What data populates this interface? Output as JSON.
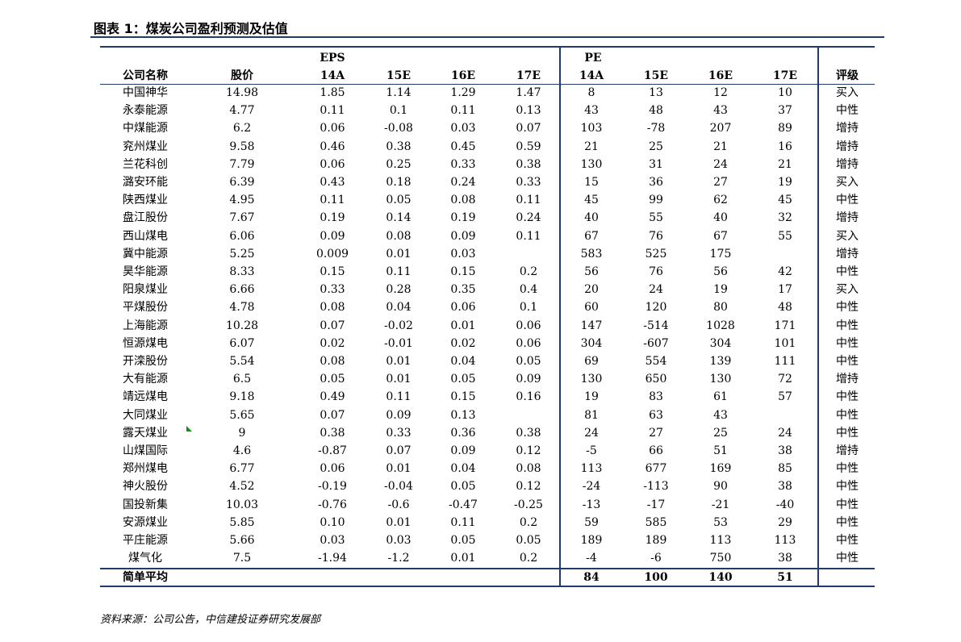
{
  "title": "图表 1：煤炭公司盈利预测及估值",
  "headers": {
    "eps_group": "EPS",
    "pe_group": "PE",
    "name": "公司名称",
    "price": "股价",
    "eps_14a": "14A",
    "eps_15e": "15E",
    "eps_16e": "16E",
    "eps_17e": "17E",
    "pe_14a": "14A",
    "pe_15e": "15E",
    "pe_16e": "16E",
    "pe_17e": "17E",
    "rating": "评级"
  },
  "rows": [
    {
      "name": "中国神华",
      "price": "14.98",
      "eps": [
        "1.85",
        "1.14",
        "1.29",
        "1.47"
      ],
      "pe": [
        "8",
        "13",
        "12",
        "10"
      ],
      "rating": "买入"
    },
    {
      "name": "永泰能源",
      "price": "4.77",
      "eps": [
        "0.11",
        "0.1",
        "0.11",
        "0.13"
      ],
      "pe": [
        "43",
        "48",
        "43",
        "37"
      ],
      "rating": "中性"
    },
    {
      "name": "中煤能源",
      "price": "6.2",
      "eps": [
        "0.06",
        "-0.08",
        "0.03",
        "0.07"
      ],
      "pe": [
        "103",
        "-78",
        "207",
        "89"
      ],
      "rating": "增持"
    },
    {
      "name": "兖州煤业",
      "price": "9.58",
      "eps": [
        "0.46",
        "0.38",
        "0.45",
        "0.59"
      ],
      "pe": [
        "21",
        "25",
        "21",
        "16"
      ],
      "rating": "增持"
    },
    {
      "name": "兰花科创",
      "price": "7.79",
      "eps": [
        "0.06",
        "0.25",
        "0.33",
        "0.38"
      ],
      "pe": [
        "130",
        "31",
        "24",
        "21"
      ],
      "rating": "增持"
    },
    {
      "name": "潞安环能",
      "price": "6.39",
      "eps": [
        "0.43",
        "0.18",
        "0.24",
        "0.33"
      ],
      "pe": [
        "15",
        "36",
        "27",
        "19"
      ],
      "rating": "买入"
    },
    {
      "name": "陕西煤业",
      "price": "4.95",
      "eps": [
        "0.11",
        "0.05",
        "0.08",
        "0.11"
      ],
      "pe": [
        "45",
        "99",
        "62",
        "45"
      ],
      "rating": "中性"
    },
    {
      "name": "盘江股份",
      "price": "7.67",
      "eps": [
        "0.19",
        "0.14",
        "0.19",
        "0.24"
      ],
      "pe": [
        "40",
        "55",
        "40",
        "32"
      ],
      "rating": "增持"
    },
    {
      "name": "西山煤电",
      "price": "6.06",
      "eps": [
        "0.09",
        "0.08",
        "0.09",
        "0.11"
      ],
      "pe": [
        "67",
        "76",
        "67",
        "55"
      ],
      "rating": "买入"
    },
    {
      "name": "冀中能源",
      "price": "5.25",
      "eps": [
        "0.009",
        "0.01",
        "0.03",
        ""
      ],
      "pe": [
        "583",
        "525",
        "175",
        ""
      ],
      "rating": "增持"
    },
    {
      "name": "昊华能源",
      "price": "8.33",
      "eps": [
        "0.15",
        "0.11",
        "0.15",
        "0.2"
      ],
      "pe": [
        "56",
        "76",
        "56",
        "42"
      ],
      "rating": "中性"
    },
    {
      "name": "阳泉煤业",
      "price": "6.66",
      "eps": [
        "0.33",
        "0.28",
        "0.35",
        "0.4"
      ],
      "pe": [
        "20",
        "24",
        "19",
        "17"
      ],
      "rating": "买入"
    },
    {
      "name": "平煤股份",
      "price": "4.78",
      "eps": [
        "0.08",
        "0.04",
        "0.06",
        "0.1"
      ],
      "pe": [
        "60",
        "120",
        "80",
        "48"
      ],
      "rating": "中性"
    },
    {
      "name": "上海能源",
      "price": "10.28",
      "eps": [
        "0.07",
        "-0.02",
        "0.01",
        "0.06"
      ],
      "pe": [
        "147",
        "-514",
        "1028",
        "171"
      ],
      "rating": "中性"
    },
    {
      "name": "恒源煤电",
      "price": "6.07",
      "eps": [
        "0.02",
        "-0.01",
        "0.02",
        "0.06"
      ],
      "pe": [
        "304",
        "-607",
        "304",
        "101"
      ],
      "rating": "中性"
    },
    {
      "name": "开滦股份",
      "price": "5.54",
      "eps": [
        "0.08",
        "0.01",
        "0.04",
        "0.05"
      ],
      "pe": [
        "69",
        "554",
        "139",
        "111"
      ],
      "rating": "中性"
    },
    {
      "name": "大有能源",
      "price": "6.5",
      "eps": [
        "0.05",
        "0.01",
        "0.05",
        "0.09"
      ],
      "pe": [
        "130",
        "650",
        "130",
        "72"
      ],
      "rating": "增持"
    },
    {
      "name": "靖远煤电",
      "price": "9.18",
      "eps": [
        "0.49",
        "0.11",
        "0.15",
        "0.16"
      ],
      "pe": [
        "19",
        "83",
        "61",
        "57"
      ],
      "rating": "中性"
    },
    {
      "name": "大同煤业",
      "price": "5.65",
      "eps": [
        "0.07",
        "0.09",
        "0.13",
        ""
      ],
      "pe": [
        "81",
        "63",
        "43",
        ""
      ],
      "rating": "中性"
    },
    {
      "name": "露天煤业",
      "price": "9",
      "eps": [
        "0.38",
        "0.33",
        "0.36",
        "0.38"
      ],
      "pe": [
        "24",
        "27",
        "25",
        "24"
      ],
      "rating": "中性"
    },
    {
      "name": "山煤国际",
      "price": "4.6",
      "eps": [
        "-0.87",
        "0.07",
        "0.09",
        "0.12"
      ],
      "pe": [
        "-5",
        "66",
        "51",
        "38"
      ],
      "rating": "增持"
    },
    {
      "name": "郑州煤电",
      "price": "6.77",
      "eps": [
        "0.06",
        "0.01",
        "0.04",
        "0.08"
      ],
      "pe": [
        "113",
        "677",
        "169",
        "85"
      ],
      "rating": "中性"
    },
    {
      "name": "神火股份",
      "price": "4.52",
      "eps": [
        "-0.19",
        "-0.04",
        "0.05",
        "0.12"
      ],
      "pe": [
        "-24",
        "-113",
        "90",
        "38"
      ],
      "rating": "中性"
    },
    {
      "name": "国投新集",
      "price": "10.03",
      "eps": [
        "-0.76",
        "-0.6",
        "-0.47",
        "-0.25"
      ],
      "pe": [
        "-13",
        "-17",
        "-21",
        "-40"
      ],
      "rating": "中性"
    },
    {
      "name": "安源煤业",
      "price": "5.85",
      "eps": [
        "0.10",
        "0.01",
        "0.11",
        "0.2"
      ],
      "pe": [
        "59",
        "585",
        "53",
        "29"
      ],
      "rating": "中性"
    },
    {
      "name": "平庄能源",
      "price": "5.66",
      "eps": [
        "0.03",
        "0.03",
        "0.05",
        "0.05"
      ],
      "pe": [
        "189",
        "189",
        "113",
        "113"
      ],
      "rating": "中性"
    },
    {
      "name": "煤气化",
      "price": "7.5",
      "eps": [
        "-1.94",
        "-1.2",
        "0.01",
        "0.2"
      ],
      "pe": [
        "-4",
        "-6",
        "750",
        "38"
      ],
      "rating": "中性"
    }
  ],
  "average": {
    "label": "简单平均",
    "pe": [
      "84",
      "100",
      "140",
      "51"
    ]
  },
  "source": "资料来源：公司公告，中信建投证券研究发展部"
}
